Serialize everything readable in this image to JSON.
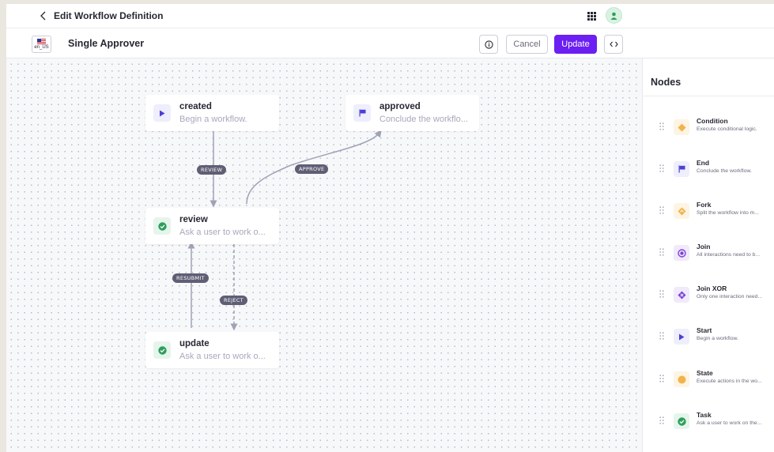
{
  "header": {
    "title": "Edit Workflow Definition",
    "back_icon": "chevron-left-icon",
    "apps_icon": "apps-grid-icon",
    "avatar_icon": "user-avatar-icon"
  },
  "toolbar": {
    "language": "en_US",
    "workflow_name": "Single Approver",
    "cancel_label": "Cancel",
    "update_label": "Update",
    "info_icon": "info-icon",
    "code_icon": "code-icon",
    "accent_color": "#6c1ff2"
  },
  "canvas": {
    "nodes": [
      {
        "id": "created",
        "title": "created",
        "description": "Begin a workflow.",
        "icon": "play-icon",
        "color": "#4b3fd6"
      },
      {
        "id": "approved",
        "title": "approved",
        "description": "Conclude the workflo...",
        "icon": "flag-icon",
        "color": "#4b3fd6"
      },
      {
        "id": "review",
        "title": "review",
        "description": "Ask a user to work o...",
        "icon": "check-circle-icon",
        "color": "#2e9e5b"
      },
      {
        "id": "update",
        "title": "update",
        "description": "Ask a user to work o...",
        "icon": "check-circle-icon",
        "color": "#2e9e5b"
      }
    ],
    "edges": [
      {
        "label": "REVIEW",
        "from": "created",
        "to": "review"
      },
      {
        "label": "APPROVE",
        "from": "review",
        "to": "approved"
      },
      {
        "label": "RESUBMIT",
        "from": "update",
        "to": "review"
      },
      {
        "label": "REJECT",
        "from": "review",
        "to": "update"
      }
    ]
  },
  "sidebar": {
    "title": "Nodes",
    "items": [
      {
        "name": "Condition",
        "description": "Execute conditional logic.",
        "icon": "diamond-icon",
        "color": "#f3b24a"
      },
      {
        "name": "End",
        "description": "Conclude the workflow.",
        "icon": "flag-icon",
        "color": "#4b3fd6"
      },
      {
        "name": "Fork",
        "description": "Split the workflow into m...",
        "icon": "fork-icon",
        "color": "#f3b24a"
      },
      {
        "name": "Join",
        "description": "All interactions need to b...",
        "icon": "join-icon",
        "color": "#7b42d9"
      },
      {
        "name": "Join XOR",
        "description": "Only one interaction need...",
        "icon": "join-xor-icon",
        "color": "#7b42d9"
      },
      {
        "name": "Start",
        "description": "Begin a workflow.",
        "icon": "play-icon",
        "color": "#4b3fd6"
      },
      {
        "name": "State",
        "description": "Execute actions in the wo...",
        "icon": "circle-icon",
        "color": "#f3b24a"
      },
      {
        "name": "Task",
        "description": "Ask a user to work on the...",
        "icon": "check-circle-icon",
        "color": "#2e9e5b"
      }
    ]
  }
}
